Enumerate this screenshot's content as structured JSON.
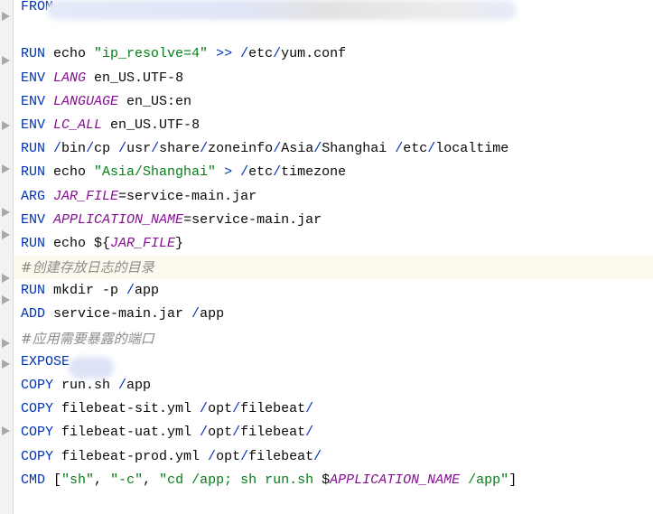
{
  "editor": {
    "current_line": 11,
    "lines": [
      [
        [
          "kw",
          "FROM"
        ]
      ],
      [],
      [
        [
          "kw",
          "RUN"
        ],
        [
          "t",
          " echo "
        ],
        [
          "str",
          "\"ip_resolve=4\""
        ],
        [
          "t",
          " "
        ],
        [
          "op",
          ">>"
        ],
        [
          "t",
          " "
        ],
        [
          "op",
          "/"
        ],
        [
          "t",
          "etc"
        ],
        [
          "op",
          "/"
        ],
        [
          "t",
          "yum.conf"
        ]
      ],
      [
        [
          "kw",
          "ENV"
        ],
        [
          "t",
          " "
        ],
        [
          "var",
          "LANG"
        ],
        [
          "t",
          " en_US.UTF-8"
        ]
      ],
      [
        [
          "kw",
          "ENV"
        ],
        [
          "t",
          " "
        ],
        [
          "var",
          "LANGUAGE"
        ],
        [
          "t",
          " en_US:en"
        ]
      ],
      [
        [
          "kw",
          "ENV"
        ],
        [
          "t",
          " "
        ],
        [
          "var",
          "LC_ALL"
        ],
        [
          "t",
          " en_US.UTF-8"
        ]
      ],
      [
        [
          "kw",
          "RUN"
        ],
        [
          "t",
          " "
        ],
        [
          "op",
          "/"
        ],
        [
          "t",
          "bin"
        ],
        [
          "op",
          "/"
        ],
        [
          "t",
          "cp "
        ],
        [
          "op",
          "/"
        ],
        [
          "t",
          "usr"
        ],
        [
          "op",
          "/"
        ],
        [
          "t",
          "share"
        ],
        [
          "op",
          "/"
        ],
        [
          "t",
          "zoneinfo"
        ],
        [
          "op",
          "/"
        ],
        [
          "t",
          "Asia"
        ],
        [
          "op",
          "/"
        ],
        [
          "t",
          "Shanghai "
        ],
        [
          "op",
          "/"
        ],
        [
          "t",
          "etc"
        ],
        [
          "op",
          "/"
        ],
        [
          "t",
          "localtime"
        ]
      ],
      [
        [
          "kw",
          "RUN"
        ],
        [
          "t",
          " echo "
        ],
        [
          "str",
          "\"Asia/Shanghai\""
        ],
        [
          "t",
          " "
        ],
        [
          "op",
          ">"
        ],
        [
          "t",
          " "
        ],
        [
          "op",
          "/"
        ],
        [
          "t",
          "etc"
        ],
        [
          "op",
          "/"
        ],
        [
          "t",
          "timezone"
        ]
      ],
      [
        [
          "kw",
          "ARG"
        ],
        [
          "t",
          " "
        ],
        [
          "var",
          "JAR_FILE"
        ],
        [
          "t",
          "=service-main.jar"
        ]
      ],
      [
        [
          "kw",
          "ENV"
        ],
        [
          "t",
          " "
        ],
        [
          "var",
          "APPLICATION_NAME"
        ],
        [
          "t",
          "=service-main.jar"
        ]
      ],
      [
        [
          "kw",
          "RUN"
        ],
        [
          "t",
          " echo ${"
        ],
        [
          "var",
          "JAR_FILE"
        ],
        [
          "t",
          "}"
        ]
      ],
      [
        [
          "cmt",
          "#创建存放日志的目录"
        ]
      ],
      [
        [
          "kw",
          "RUN"
        ],
        [
          "t",
          " mkdir -p "
        ],
        [
          "op",
          "/"
        ],
        [
          "t",
          "app"
        ]
      ],
      [
        [
          "kw",
          "ADD"
        ],
        [
          "t",
          " service-main.jar "
        ],
        [
          "op",
          "/"
        ],
        [
          "t",
          "app"
        ]
      ],
      [
        [
          "cmt",
          "#应用需要暴露的端口"
        ]
      ],
      [
        [
          "kw",
          "EXPOSE"
        ]
      ],
      [
        [
          "kw",
          "COPY"
        ],
        [
          "t",
          " run.sh "
        ],
        [
          "op",
          "/"
        ],
        [
          "t",
          "app"
        ]
      ],
      [
        [
          "kw",
          "COPY"
        ],
        [
          "t",
          " filebeat-sit.yml "
        ],
        [
          "op",
          "/"
        ],
        [
          "t",
          "opt"
        ],
        [
          "op",
          "/"
        ],
        [
          "t",
          "filebeat"
        ],
        [
          "op",
          "/"
        ]
      ],
      [
        [
          "kw",
          "COPY"
        ],
        [
          "t",
          " filebeat-uat.yml "
        ],
        [
          "op",
          "/"
        ],
        [
          "t",
          "opt"
        ],
        [
          "op",
          "/"
        ],
        [
          "t",
          "filebeat"
        ],
        [
          "op",
          "/"
        ]
      ],
      [
        [
          "kw",
          "COPY"
        ],
        [
          "t",
          " filebeat-prod.yml "
        ],
        [
          "op",
          "/"
        ],
        [
          "t",
          "opt"
        ],
        [
          "op",
          "/"
        ],
        [
          "t",
          "filebeat"
        ],
        [
          "op",
          "/"
        ]
      ],
      [
        [
          "kw",
          "CMD"
        ],
        [
          "t",
          " ["
        ],
        [
          "str",
          "\"sh\""
        ],
        [
          "t",
          ", "
        ],
        [
          "str",
          "\"-c\""
        ],
        [
          "t",
          ", "
        ],
        [
          "str",
          "\"cd /app; sh run.sh "
        ],
        [
          "t",
          "$"
        ],
        [
          "var",
          "APPLICATION_NAME"
        ],
        [
          "str",
          " /app\""
        ],
        [
          "t",
          "]"
        ]
      ]
    ]
  }
}
